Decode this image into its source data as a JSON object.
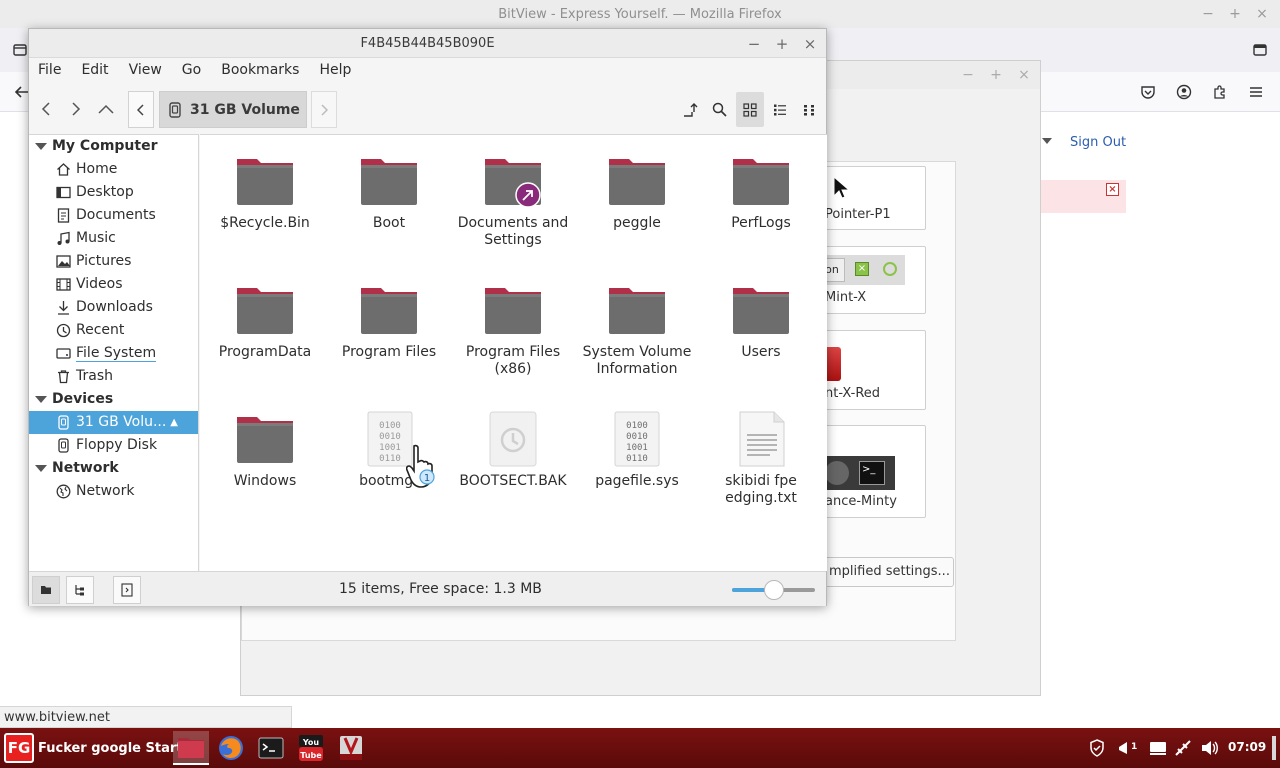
{
  "firefox": {
    "title": "BitView - Express Yourself. — Mozilla Firefox",
    "sign_out": "Sign Out",
    "status_url": "www.bitview.net"
  },
  "themes_window": {
    "tiles": [
      "Pointer-P1",
      "Mint-X",
      "nt-X-Red",
      "ance-Minty"
    ],
    "button_label": "on",
    "simplified_button": "mplified settings..."
  },
  "nemo": {
    "title": "F4B45B44B45B090E",
    "menu": [
      "File",
      "Edit",
      "View",
      "Go",
      "Bookmarks",
      "Help"
    ],
    "path": "31 GB Volume",
    "sidebar": {
      "my_computer": "My Computer",
      "places": [
        {
          "label": "Home",
          "icon": "home-icon"
        },
        {
          "label": "Desktop",
          "icon": "desktop-icon"
        },
        {
          "label": "Documents",
          "icon": "documents-icon"
        },
        {
          "label": "Music",
          "icon": "music-icon"
        },
        {
          "label": "Pictures",
          "icon": "pictures-icon"
        },
        {
          "label": "Videos",
          "icon": "videos-icon"
        },
        {
          "label": "Downloads",
          "icon": "downloads-icon"
        },
        {
          "label": "Recent",
          "icon": "recent-icon"
        },
        {
          "label": "File System",
          "icon": "filesystem-icon"
        },
        {
          "label": "Trash",
          "icon": "trash-icon"
        }
      ],
      "devices": "Devices",
      "device_items": [
        {
          "label": "31 GB Volu...",
          "icon": "drive-icon"
        },
        {
          "label": "Floppy Disk",
          "icon": "floppy-icon"
        }
      ],
      "network": "Network",
      "network_items": [
        {
          "label": "Network",
          "icon": "network-icon"
        }
      ]
    },
    "files": [
      {
        "name": "$Recycle.Bin",
        "type": "folder"
      },
      {
        "name": "Boot",
        "type": "folder"
      },
      {
        "name": "Documents and Settings",
        "type": "folder-link"
      },
      {
        "name": "peggle",
        "type": "folder"
      },
      {
        "name": "PerfLogs",
        "type": "folder"
      },
      {
        "name": "ProgramData",
        "type": "folder"
      },
      {
        "name": "Program Files",
        "type": "folder"
      },
      {
        "name": "Program Files (x86)",
        "type": "folder"
      },
      {
        "name": "System Volume Information",
        "type": "folder"
      },
      {
        "name": "Users",
        "type": "folder"
      },
      {
        "name": "Windows",
        "type": "folder"
      },
      {
        "name": "bootmgr",
        "type": "binary"
      },
      {
        "name": "BOOTSECT.BAK",
        "type": "backup"
      },
      {
        "name": "pagefile.sys",
        "type": "binary"
      },
      {
        "name": "skibidi fpe edging.txt",
        "type": "text"
      }
    ],
    "status": "15 items, Free space: 1.3 MB",
    "zoom_level": 0.5
  },
  "taskbar": {
    "start_label": "Fucker google Start",
    "start_logo": "FG",
    "clock": "07:09"
  },
  "colors": {
    "folder_body": "#6d6d6d",
    "folder_tab": "#b0304a",
    "selection": "#4ca4db",
    "taskbar": "#6a0e0e"
  }
}
